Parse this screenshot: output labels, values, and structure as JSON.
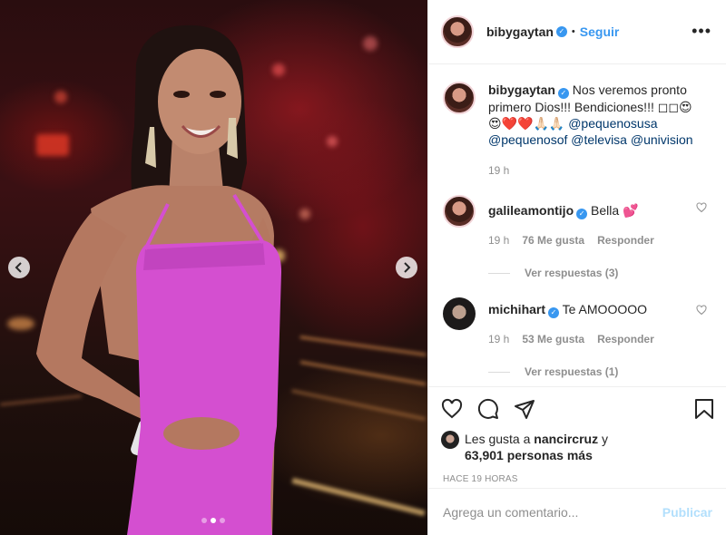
{
  "post": {
    "username": "bibygaytan",
    "follow_label": "Seguir",
    "separator": "•",
    "more_label": "•••",
    "media_dots": 3,
    "active_dot": 1
  },
  "caption": {
    "username": "bibygaytan",
    "text": "Nos veremos pronto primero Dios!!! Bendiciones!!! ◻◻😍😍❤️❤️🙏🏻🙏🏻",
    "mentions": [
      "@pequenosusa",
      "@pequenosof",
      "@televisa",
      "@univision"
    ],
    "time": "19 h"
  },
  "comments": [
    {
      "username": "galileamontijo",
      "text": "Bella 💕",
      "time": "19 h",
      "likes": "76 Me gusta",
      "reply_label": "Responder",
      "view_replies": "Ver respuestas (3)"
    },
    {
      "username": "michihart",
      "text": "Te AMOOOOO",
      "time": "19 h",
      "likes": "53 Me gusta",
      "reply_label": "Responder",
      "view_replies": "Ver respuestas (1)"
    }
  ],
  "likes": {
    "prefix": "Les gusta a",
    "user": "nancircruz",
    "connector": "y",
    "count_text": "63,901 personas más"
  },
  "timestamp": "HACE 19 HORAS",
  "comment_box": {
    "placeholder": "Agrega un comentario...",
    "publish_label": "Publicar"
  },
  "colors": {
    "accent": "#3897f0",
    "publish_disabled": "#b2dffc",
    "dress": "#d44fd0",
    "mention": "#00376b"
  }
}
